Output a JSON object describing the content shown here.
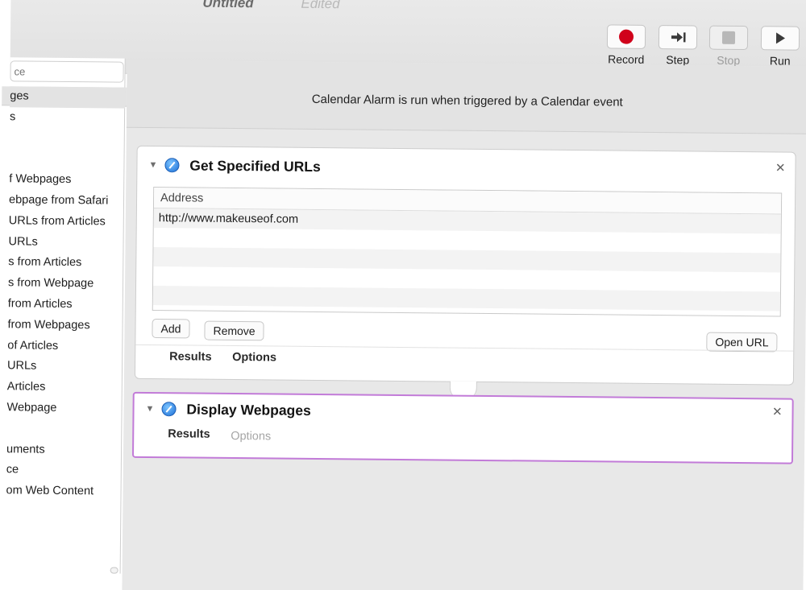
{
  "window": {
    "document_title": "Untitled",
    "edited_label": "Edited"
  },
  "toolbar": {
    "record_label": "Record",
    "step_label": "Step",
    "stop_label": "Stop",
    "run_label": "Run"
  },
  "library": {
    "search_placeholder": "ce",
    "items": [
      "ges",
      "s",
      "",
      "",
      "f Webpages",
      "ebpage from Safari",
      "URLs from Articles",
      "URLs",
      "s from Articles",
      "s from Webpage",
      "from Articles",
      "from Webpages",
      "of Articles",
      "URLs",
      "Articles",
      "Webpage",
      "",
      "uments",
      "ce",
      "om Web Content"
    ]
  },
  "workflow": {
    "trigger_text": "Calendar Alarm is run when triggered by a Calendar event",
    "actions": [
      {
        "title": "Get Specified URLs",
        "address_header": "Address",
        "urls": [
          "http://www.makeuseof.com",
          "",
          "",
          "",
          "",
          ""
        ],
        "add_label": "Add",
        "remove_label": "Remove",
        "open_url_label": "Open URL",
        "results_label": "Results",
        "options_label": "Options"
      },
      {
        "title": "Display Webpages",
        "results_label": "Results",
        "options_label": "Options"
      }
    ]
  },
  "colors": {
    "record_red": "#d0021b",
    "selected_action_border": "#c27bd8",
    "safari_blue": "#1c6fd6"
  },
  "icons": [
    "record-icon",
    "step-icon",
    "stop-icon",
    "run-icon",
    "safari-icon",
    "close-icon",
    "disclosure-triangle-icon"
  ]
}
